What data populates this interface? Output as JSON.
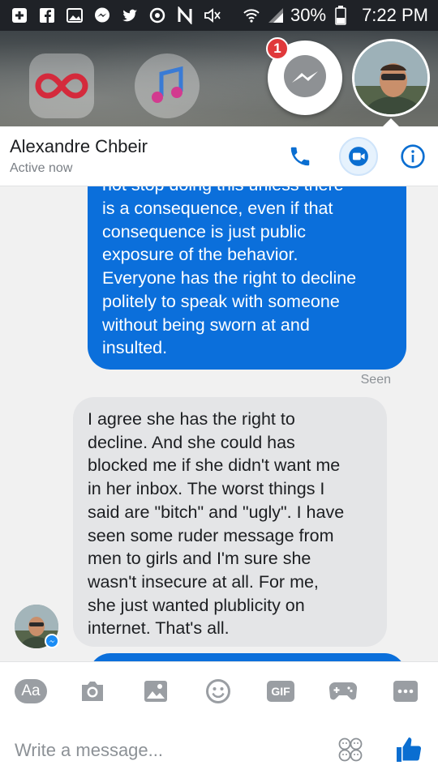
{
  "status_bar": {
    "battery": "30%",
    "time": "7:22 PM",
    "icons": [
      "plus-box-icon",
      "facebook-icon",
      "image-icon",
      "messenger-icon",
      "twitter-icon",
      "sync-icon",
      "nfc-icon",
      "mute-icon",
      "wifi-icon",
      "signal-icon",
      "battery-icon"
    ]
  },
  "chat_heads": {
    "badge_count": "1"
  },
  "header": {
    "contact_name": "Alexandre Chbeir",
    "status": "Active now"
  },
  "messages": [
    {
      "direction": "outgoing",
      "lines": [
        "not stop doing this unless there",
        "is a consequence, even if that",
        "consequence is just public",
        "exposure of the behavior.",
        "Everyone has the right to decline",
        "politely to speak with someone",
        "without being sworn at and",
        "insulted."
      ]
    },
    {
      "direction": "incoming",
      "lines": [
        "I agree she has the right to",
        "decline. And she could has",
        "blocked me if she didn't want me",
        "in her inbox. The worst things I",
        "said are \"bitch\" and \"ugly\". I have",
        "seen some ruder message from",
        "men to girls and I'm sure she",
        "wasn't insecure at all. For me,",
        "she just wanted plublicity on",
        "internet. That's all."
      ]
    }
  ],
  "seen_label": "Seen",
  "composer": {
    "aa_label": "Aa",
    "gif_label": "GIF",
    "placeholder": "Write a message..."
  },
  "colors": {
    "accent": "#0b6fdb",
    "incoming_bubble": "#e4e5e7",
    "badge": "#e0393b"
  }
}
